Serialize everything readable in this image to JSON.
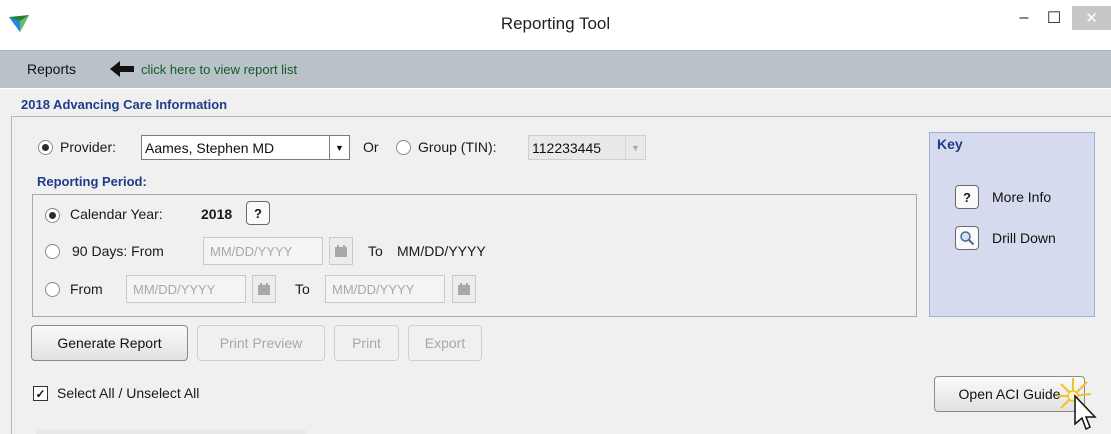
{
  "window": {
    "title": "Reporting Tool",
    "minimize": "–",
    "maximize": "☐",
    "close": "✕"
  },
  "menubar": {
    "reports_label": "Reports",
    "hint": "click here to view report list"
  },
  "section": {
    "title": "2018 Advancing Care Information"
  },
  "provider": {
    "label": "Provider:",
    "selected": "Aames, Stephen MD",
    "or_label": "Or",
    "group_label": "Group (TIN):",
    "group_value": "112233445"
  },
  "reporting_period": {
    "title": "Reporting Period:",
    "calendar_year_label": "Calendar Year:",
    "calendar_year_value": "2018",
    "help": "?",
    "days90_label": "90 Days:  From",
    "days90_from_placeholder": "MM/DD/YYYY",
    "days90_to_label": "To",
    "days90_to_value": "MM/DD/YYYY",
    "from_label": "From",
    "from_placeholder": "MM/DD/YYYY",
    "to_label": "To",
    "to_placeholder": "MM/DD/YYYY"
  },
  "buttons": {
    "generate": "Generate Report",
    "print_preview": "Print Preview",
    "print": "Print",
    "export": "Export",
    "open_aci_guide": "Open ACI Guide"
  },
  "select_all_label": "Select All / Unselect All",
  "key": {
    "title": "Key",
    "more_info_icon": "?",
    "more_info_label": "More Info",
    "drill_down_label": "Drill Down"
  },
  "colors": {
    "accent_blue": "#1f3c88",
    "hint_green": "#155a2a",
    "menubar_bg": "#b9c2c9",
    "key_bg": "#d5daee"
  }
}
